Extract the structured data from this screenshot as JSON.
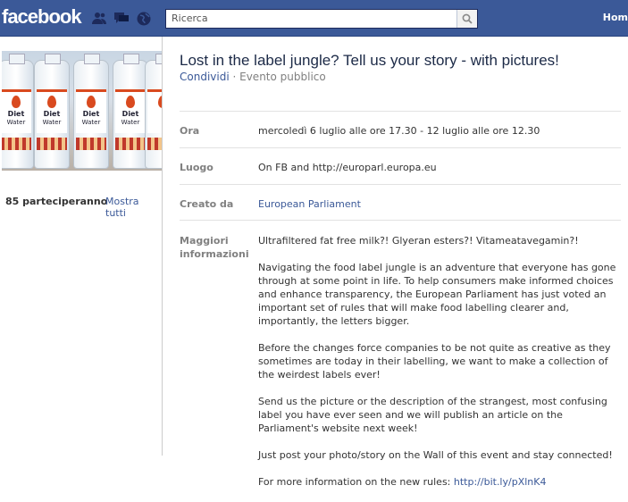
{
  "header": {
    "logo": "facebook",
    "search_placeholder": "Ricerca",
    "home_label": "Hom",
    "icons": [
      "friends-icon",
      "messages-icon",
      "notifications-globe-icon",
      "search-icon"
    ]
  },
  "left": {
    "photo_alt": "Diet Water bottles",
    "bottle_text_1": "Diet",
    "bottle_text_2": "Water",
    "attending": "85 parteciperanno",
    "show_all": "Mostra tutti"
  },
  "event": {
    "title": "Lost in the label jungle? Tell us your story - with pictures!",
    "share": "Condividi",
    "separator": " · ",
    "type": "Evento pubblico",
    "details": {
      "time_label": "Ora",
      "time_value": "mercoledì 6 luglio alle ore 17.30 - 12 luglio alle ore 12.30",
      "place_label": "Luogo",
      "place_value": "On FB and http://europarl.europa.eu",
      "creator_label": "Creato da",
      "creator_value": "European Parliament",
      "info_label": "Maggiori informazioni",
      "info_paragraphs": [
        "Ultrafiltered fat free milk?! Glyeran esters?! Vitameatavegamin?!",
        "Navigating the food label jungle is an adventure that everyone has gone through at some point in life. To help consumers make informed choices and enhance transparency, the European Parliament has just voted an important set of rules that will make food labelling clearer and, importantly, the letters bigger.",
        "Before the changes force companies to be not quite as creative as they sometimes are today in their labelling, we want to make a collection of the weirdest labels ever!",
        "Send us the picture or the description of the strangest, most confusing label you have ever seen and we will publish an article on the Parliament's website next week!",
        "Just post your photo/story on the Wall of this event and stay connected!"
      ],
      "more_info_prefix": "For more information on the new rules: ",
      "more_info_link": "http://bit.ly/pXlnK4"
    }
  },
  "colors": {
    "brand": "#3b5998",
    "link": "#3b5998",
    "muted": "#808080"
  }
}
